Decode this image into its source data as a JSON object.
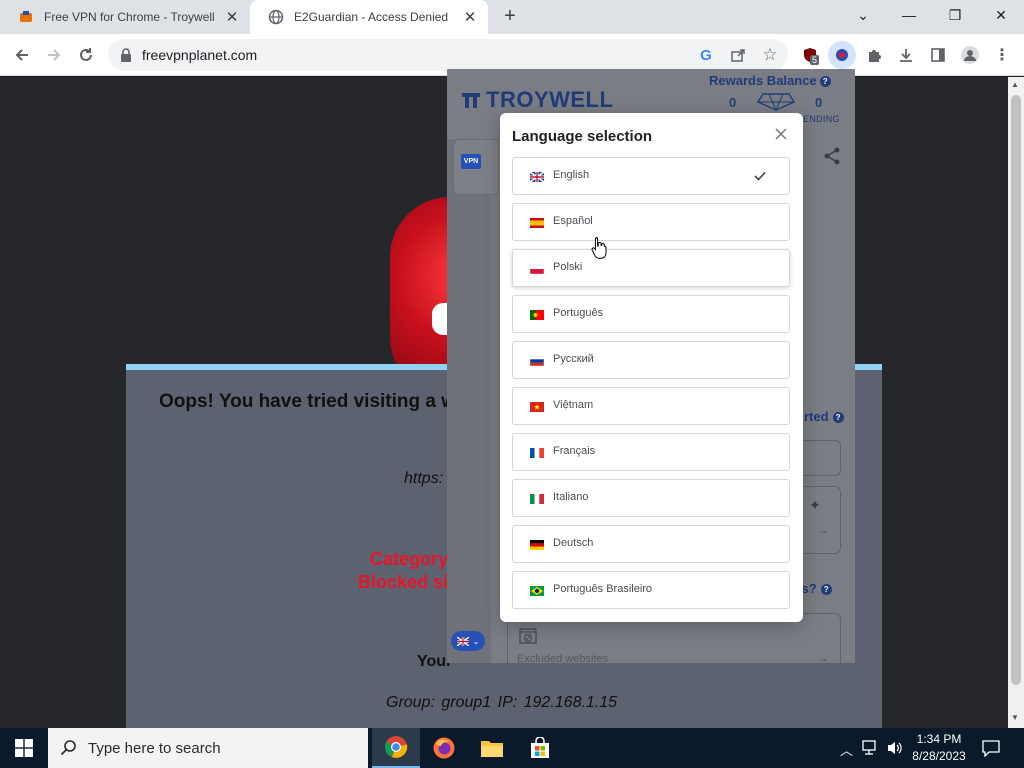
{
  "browser": {
    "tabs": [
      {
        "title": "Free VPN for Chrome - Troywell",
        "active": false
      },
      {
        "title": "E2Guardian - Access Denied",
        "active": true
      }
    ],
    "url": "freevpnplanet.com",
    "extension_badge": "5"
  },
  "blocked_page": {
    "title": "Oops! You have tried visiting a we",
    "url_fragment": "https:",
    "category_line1": "Category",
    "category_line2": "Blocked si",
    "your_label": "Your",
    "group_line": "Group: group1   IP: 192.168.1.15"
  },
  "extension": {
    "brand": "TROYWELL",
    "rewards_label": "Rewards Balance",
    "rewards_value": "0",
    "pending_value": "0",
    "pending_label": "ENDING",
    "vpn_badge": "VPN",
    "started_label": "rted",
    "this_label": "his?",
    "excluded_label": "Excluded websites"
  },
  "modal": {
    "title": "Language selection",
    "languages": [
      {
        "name": "English",
        "selected": true
      },
      {
        "name": "Español",
        "selected": false
      },
      {
        "name": "Polski",
        "selected": false
      },
      {
        "name": "Português",
        "selected": false
      },
      {
        "name": "Русский",
        "selected": false
      },
      {
        "name": "Việtnam",
        "selected": false
      },
      {
        "name": "Français",
        "selected": false
      },
      {
        "name": "Italiano",
        "selected": false
      },
      {
        "name": "Deutsch",
        "selected": false
      },
      {
        "name": "Português Brasileiro",
        "selected": false
      }
    ]
  },
  "taskbar": {
    "search_placeholder": "Type here to search",
    "time": "1:34 PM",
    "date": "8/28/2023"
  },
  "colors": {
    "brand_blue": "#203c78",
    "accent_blue": "#2450b8",
    "blocked_red": "#e8152a",
    "card_top": "#8fd3f4"
  }
}
